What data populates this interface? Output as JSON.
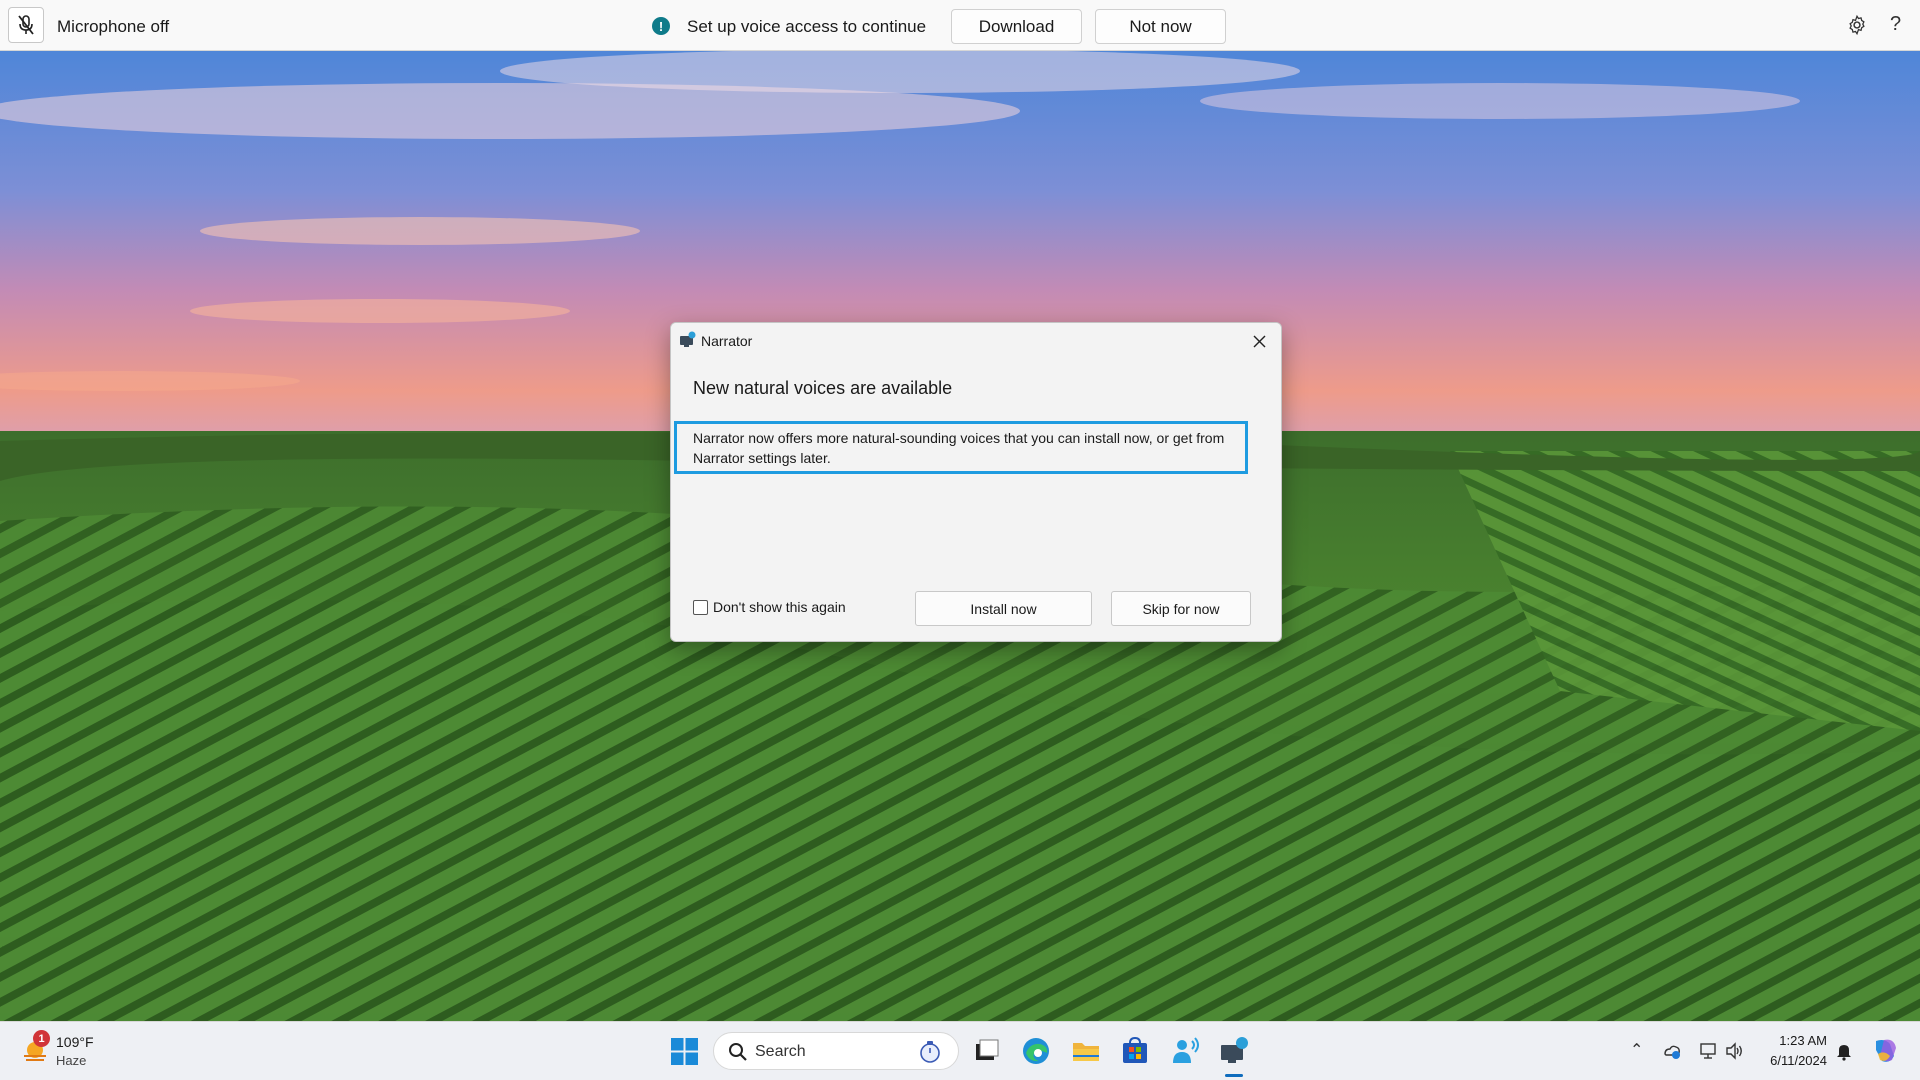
{
  "voice_access_bar": {
    "mic_status": "Microphone off",
    "message": "Set up voice access to continue",
    "download_label": "Download",
    "not_now_label": "Not now"
  },
  "dialog": {
    "app_title": "Narrator",
    "heading": "New natural voices are available",
    "body": "Narrator now offers more natural-sounding voices that you can install now, or get from Narrator settings later.",
    "checkbox_label": "Don't show this again",
    "checkbox_checked": false,
    "install_label": "Install now",
    "skip_label": "Skip for now"
  },
  "taskbar": {
    "weather": {
      "temperature": "109°F",
      "condition": "Haze",
      "badge": "1"
    },
    "search_placeholder": "Search",
    "apps": [
      "windows-start",
      "task-view",
      "edge",
      "file-explorer",
      "microsoft-store",
      "voice-access",
      "narrator"
    ],
    "tray": {
      "time": "1:23 AM",
      "date": "6/11/2024"
    }
  },
  "colors": {
    "accent": "#1e9be0",
    "info": "#0f7b8a",
    "badge": "#d13438"
  }
}
